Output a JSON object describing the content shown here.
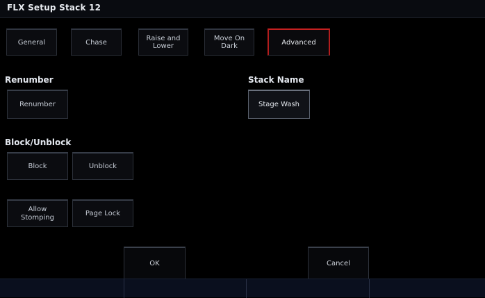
{
  "window": {
    "title": "FLX Setup Stack 12"
  },
  "tabs": [
    {
      "label": "General"
    },
    {
      "label": "Chase"
    },
    {
      "label": "Raise and\nLower"
    },
    {
      "label": "Move On\nDark"
    },
    {
      "label": "Advanced",
      "active": true
    }
  ],
  "sections": {
    "renumber_label": "Renumber",
    "renumber_button": "Renumber",
    "stack_name_label": "Stack Name",
    "stack_name_value": "Stage Wash",
    "block_label": "Block/Unblock",
    "block_button": "Block",
    "unblock_button": "Unblock",
    "allow_stomping_button": "Allow\nStomping",
    "page_lock_button": "Page Lock"
  },
  "footer": {
    "ok_label": "OK",
    "cancel_label": "Cancel"
  },
  "colors": {
    "background": "#000000",
    "active_tab_accent": "#c42020",
    "footer_bar": "#0a0f1e"
  }
}
